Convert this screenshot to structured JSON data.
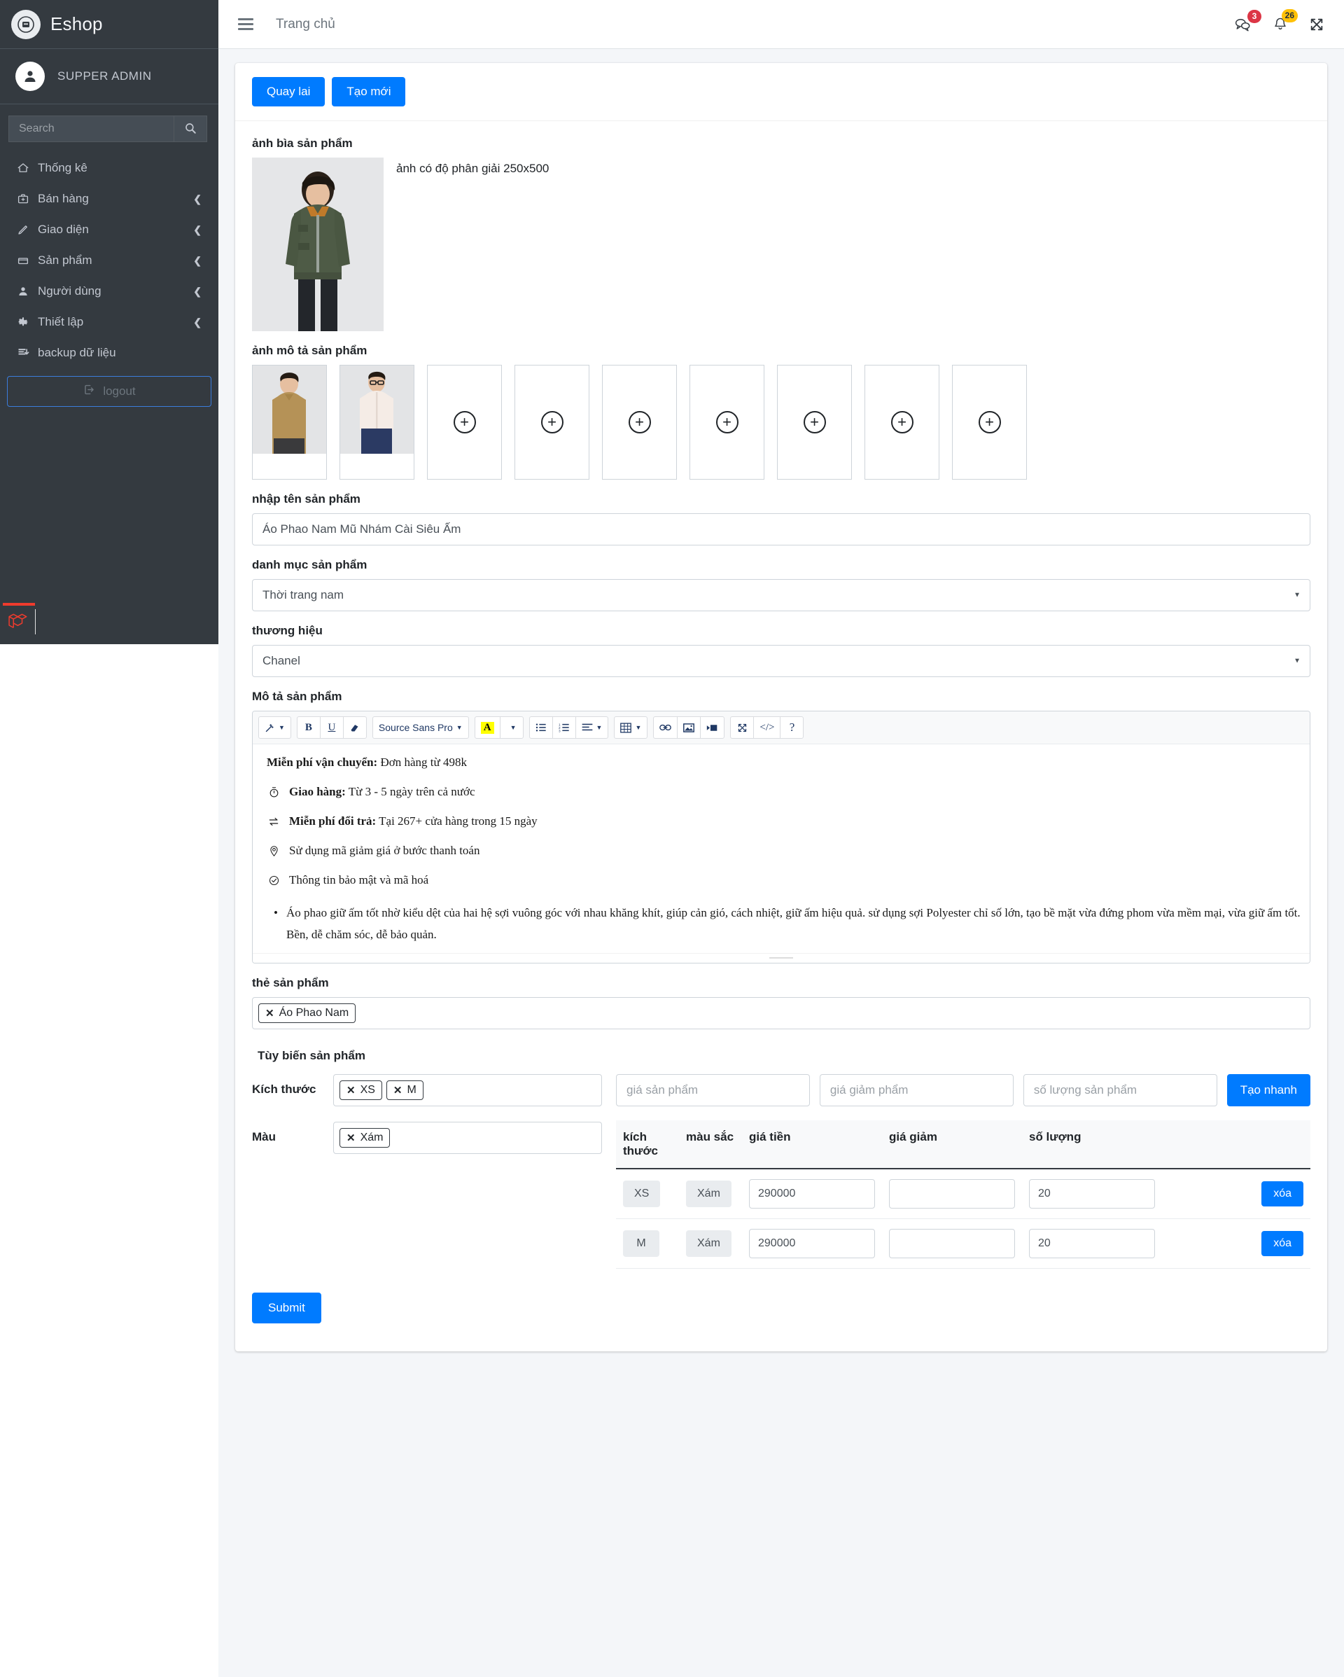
{
  "sidebar": {
    "brand": {
      "logo_icon": "eshop-logo-icon",
      "title": "Eshop"
    },
    "user": {
      "avatar_icon": "user-avatar-icon",
      "name": "SUPPER ADMIN"
    },
    "search": {
      "placeholder": "Search",
      "button_icon": "search-icon"
    },
    "items": [
      {
        "label": "Thống kê",
        "icon": "home-icon",
        "has_arrow": false
      },
      {
        "label": "Bán hàng",
        "icon": "briefcase-icon",
        "has_arrow": true
      },
      {
        "label": "Giao diện",
        "icon": "pencil-icon",
        "has_arrow": true
      },
      {
        "label": "Sản phẩm",
        "icon": "box-icon",
        "has_arrow": true
      },
      {
        "label": "Người dùng",
        "icon": "user-icon",
        "has_arrow": true
      },
      {
        "label": "Thiết lập",
        "icon": "gear-icon",
        "has_arrow": true
      },
      {
        "label": "backup dữ liệu",
        "icon": "database-download-icon",
        "has_arrow": false
      }
    ],
    "logout": {
      "label": "logout",
      "icon": "logout-icon"
    }
  },
  "topbar": {
    "menu_icon": "hamburger-icon",
    "breadcrumb": "Trang chủ",
    "chat": {
      "icon": "chat-icon",
      "badge": "3",
      "badge_color": "#dc3545"
    },
    "bell": {
      "icon": "bell-icon",
      "badge": "26",
      "badge_color": "#ffc107"
    },
    "fullscreen": {
      "icon": "fullscreen-icon"
    }
  },
  "actions": {
    "back_label": "Quay lai",
    "create_label": "Tạo mới"
  },
  "form": {
    "cover": {
      "label": "ảnh bìa sản phẩm",
      "note": "ảnh có độ phân giải 250x500"
    },
    "gallery": {
      "label": "ảnh mô tả sản phẩm",
      "add_icon": "plus-circle-icon",
      "slots": [
        {
          "filled": true
        },
        {
          "filled": true
        },
        {
          "filled": false
        },
        {
          "filled": false
        },
        {
          "filled": false
        },
        {
          "filled": false
        },
        {
          "filled": false
        },
        {
          "filled": false
        },
        {
          "filled": false
        }
      ]
    },
    "name": {
      "label": "nhập tên sản phẩm",
      "value": "Áo Phao Nam Mũ Nhám Cài Siêu Ấm"
    },
    "category": {
      "label": "danh mục sản phẩm",
      "value": "Thời trang nam"
    },
    "brand": {
      "label": "thương hiệu",
      "value": "Chanel"
    },
    "description": {
      "label": "Mô tả sản phẩm",
      "toolbar": {
        "style_icon": "magic-wand-icon",
        "bold": "B",
        "underline": "U",
        "eraser_icon": "eraser-icon",
        "font_name": "Source Sans Pro",
        "fore_color": "A",
        "ul_icon": "unordered-list-icon",
        "ol_icon": "ordered-list-icon",
        "align_icon": "align-left-icon",
        "table_icon": "table-icon",
        "link_icon": "link-icon",
        "picture_icon": "picture-icon",
        "video_icon": "video-icon",
        "fullscreen_icon": "fullscreen-icon",
        "code_icon": "code-view-icon",
        "help_icon": "help-icon"
      },
      "lines": [
        {
          "icon": "",
          "bold": "Miễn phí vận chuyển:",
          "text": "Đơn hàng từ 498k"
        },
        {
          "icon": "stopwatch-icon",
          "bold": "Giao hàng:",
          "text": "Từ 3 - 5 ngày trên cả nước"
        },
        {
          "icon": "exchange-icon",
          "bold": "Miễn phí đổi trả:",
          "text": "Tại 267+ cửa hàng trong 15 ngày"
        },
        {
          "icon": "tag-icon",
          "bold": "",
          "text": "Sử dụng mã giảm giá ở bước thanh toán"
        },
        {
          "icon": "shield-check-icon",
          "bold": "",
          "text": "Thông tin bảo mật và mã hoá"
        }
      ],
      "bullet": "Áo phao giữ ấm tốt nhờ kiểu dệt của hai hệ sợi vuông góc với nhau khăng khít, giúp cản gió, cách nhiệt, giữ ấm hiệu quả. sử dụng sợi Polyester chỉ số lớn, tạo bề mặt vừa đứng phom vừa mềm mại, vừa giữ ấm tốt. Bền, dễ chăm sóc, dễ bảo quản."
    },
    "tags": {
      "label": "thẻ sản phẩm",
      "items": [
        "Áo Phao Nam"
      ]
    },
    "variants": {
      "title": "Tùy biến sản phẩm",
      "size_label": "Kích thước",
      "size_items": [
        "XS",
        "M"
      ],
      "color_label": "Màu",
      "color_items": [
        "Xám"
      ],
      "quick": {
        "price_placeholder": "giá sản phẩm",
        "discount_placeholder": "giá giảm phẩm",
        "qty_placeholder": "số lượng sản phẩm",
        "button_label": "Tạo nhanh"
      },
      "columns": [
        "kích thước",
        "màu sắc",
        "giá tiền",
        "giá giảm",
        "số lượng"
      ],
      "rows": [
        {
          "size": "XS",
          "color": "Xám",
          "price": "290000",
          "discount": "",
          "qty": "20",
          "delete_label": "xóa"
        },
        {
          "size": "M",
          "color": "Xám",
          "price": "290000",
          "discount": "",
          "qty": "20",
          "delete_label": "xóa"
        }
      ]
    },
    "submit_label": "Submit"
  },
  "footer": {
    "logo_icon": "laravel-logo-icon",
    "accent": "#ef3b2d"
  }
}
